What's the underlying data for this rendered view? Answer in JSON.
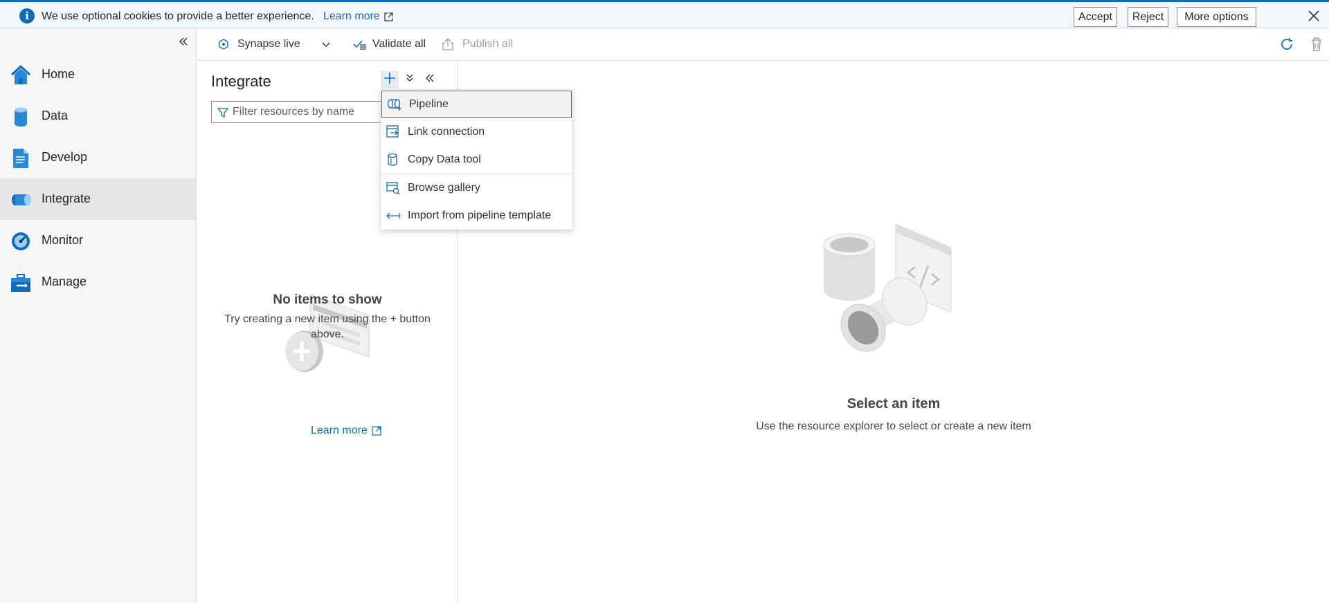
{
  "cookie_banner": {
    "message": "We use optional cookies to provide a better experience.",
    "learn_more": "Learn more",
    "accept": "Accept",
    "reject": "Reject",
    "more_options": "More options"
  },
  "nav": {
    "items": [
      {
        "label": "Home",
        "icon": "home-icon"
      },
      {
        "label": "Data",
        "icon": "database-icon"
      },
      {
        "label": "Develop",
        "icon": "document-icon"
      },
      {
        "label": "Integrate",
        "icon": "pipeline-icon",
        "active": true
      },
      {
        "label": "Monitor",
        "icon": "gauge-icon"
      },
      {
        "label": "Manage",
        "icon": "toolbox-icon"
      }
    ]
  },
  "toolbar": {
    "workspace": "Synapse live",
    "validate_all": "Validate all",
    "publish_all": "Publish all"
  },
  "integrate": {
    "title": "Integrate",
    "filter_placeholder": "Filter resources by name",
    "empty_heading": "No items to show",
    "empty_text": "Try creating a new item using the + button above.",
    "learn_more": "Learn more"
  },
  "add_menu": {
    "items": [
      {
        "label": "Pipeline",
        "icon": "pipeline-icon"
      },
      {
        "label": "Link connection",
        "icon": "link-connection-icon"
      },
      {
        "label": "Copy Data tool",
        "icon": "copy-data-icon"
      },
      {
        "label": "Browse gallery",
        "icon": "gallery-icon"
      },
      {
        "label": "Import from pipeline template",
        "icon": "import-icon"
      }
    ]
  },
  "main": {
    "empty_heading": "Select an item",
    "empty_text": "Use the resource explorer to select or create a new item"
  },
  "colors": {
    "accent": "#0f6cbd",
    "nav_bg": "#f6f6f6",
    "active_nav_bg": "#e6e6e6"
  }
}
